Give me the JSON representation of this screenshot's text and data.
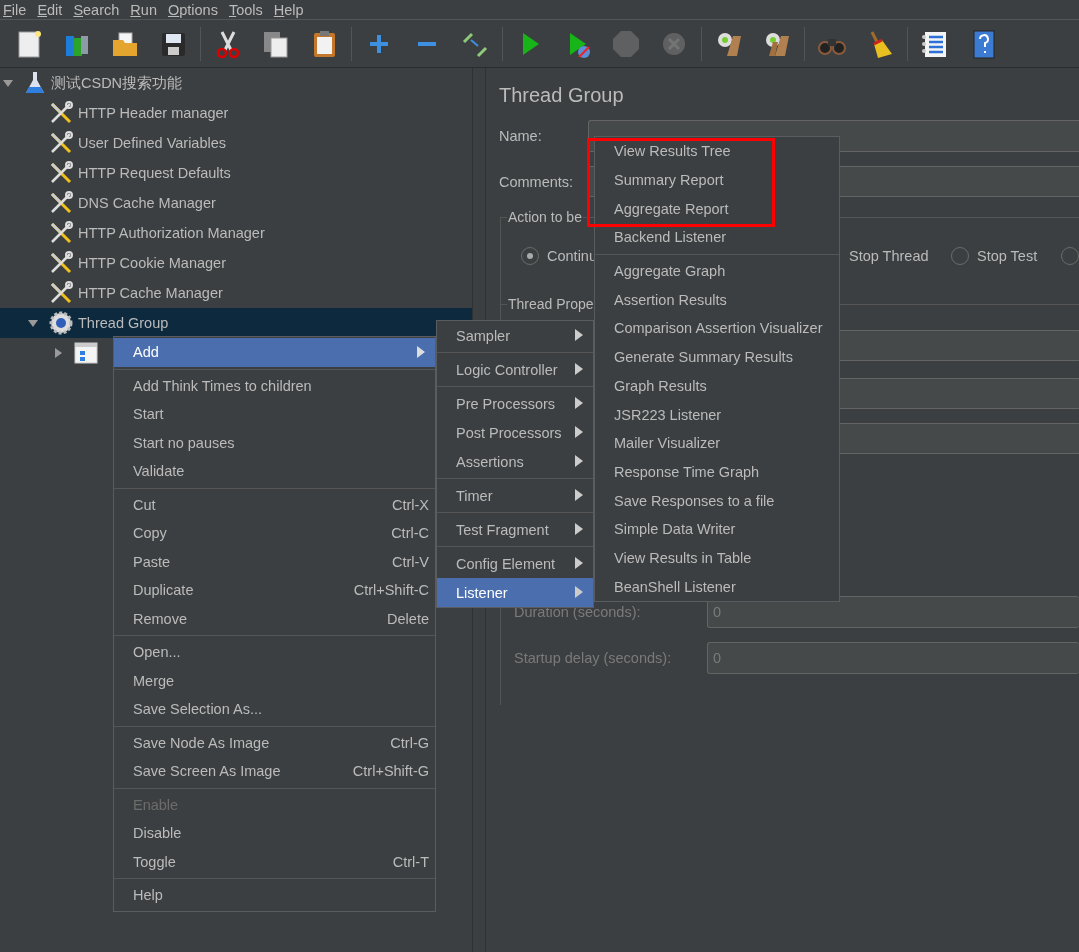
{
  "menubar": [
    "File",
    "Edit",
    "Search",
    "Run",
    "Options",
    "Tools",
    "Help"
  ],
  "toolbar": [
    {
      "kind": "new",
      "disabled": false
    },
    {
      "kind": "templates",
      "disabled": false
    },
    {
      "kind": "open",
      "disabled": false
    },
    {
      "kind": "save",
      "disabled": false
    },
    {
      "kind": "separator"
    },
    {
      "kind": "cut",
      "disabled": false
    },
    {
      "kind": "copy",
      "disabled": false
    },
    {
      "kind": "paste",
      "disabled": false
    },
    {
      "kind": "separator"
    },
    {
      "kind": "expand",
      "disabled": false
    },
    {
      "kind": "collapse",
      "disabled": false
    },
    {
      "kind": "toggle",
      "disabled": false
    },
    {
      "kind": "separator"
    },
    {
      "kind": "start",
      "disabled": false
    },
    {
      "kind": "start-no-pauses",
      "disabled": false
    },
    {
      "kind": "stop",
      "disabled": true
    },
    {
      "kind": "shutdown",
      "disabled": true
    },
    {
      "kind": "separator"
    },
    {
      "kind": "clear",
      "disabled": false
    },
    {
      "kind": "clear-all",
      "disabled": false
    },
    {
      "kind": "separator"
    },
    {
      "kind": "search",
      "disabled": false
    },
    {
      "kind": "reset-search",
      "disabled": false
    },
    {
      "kind": "separator"
    },
    {
      "kind": "functions",
      "disabled": false
    },
    {
      "kind": "help",
      "disabled": false
    }
  ],
  "tree": {
    "label": "测试CSDN搜索功能",
    "kind": "test-plan",
    "expanded": true,
    "selected": false,
    "children": [
      {
        "label": "HTTP Header manager",
        "kind": "config",
        "selected": false
      },
      {
        "label": "User Defined Variables",
        "kind": "config",
        "selected": false
      },
      {
        "label": "HTTP Request Defaults",
        "kind": "config",
        "selected": false
      },
      {
        "label": "DNS Cache Manager",
        "kind": "config",
        "selected": false
      },
      {
        "label": "HTTP Authorization Manager",
        "kind": "config",
        "selected": false
      },
      {
        "label": "HTTP Cookie Manager",
        "kind": "config",
        "selected": false
      },
      {
        "label": "HTTP Cache Manager",
        "kind": "config",
        "selected": false
      },
      {
        "label": "Thread Group",
        "kind": "thread-group",
        "expanded": true,
        "selected": true,
        "children": [
          {
            "kind": "controller",
            "expanded": false,
            "selected": false
          }
        ]
      }
    ]
  },
  "panel": {
    "title": "Thread Group",
    "name_label": "Name:",
    "comments_label": "Comments:",
    "action_section": {
      "label": "Action to be",
      "options": [
        {
          "label": "Continu",
          "selected": true
        },
        {
          "label": "Stop Thread"
        },
        {
          "label": "Stop Test",
          "selected": false
        },
        {
          "selected": false
        }
      ]
    },
    "properties_section": {
      "label": "Thread Prope",
      "fields": [
        {
          "label": "Duration (seconds):",
          "value": "0",
          "disabled": true
        },
        {
          "label": "Startup delay (seconds):",
          "value": "0",
          "disabled": true
        }
      ]
    }
  },
  "context_menu": [
    {
      "label": "Add",
      "submenu": true,
      "selected": true,
      "disabled": false
    },
    {
      "kind": "separator"
    },
    {
      "label": "Add Think Times to children",
      "selected": false,
      "disabled": false
    },
    {
      "label": "Start",
      "selected": false,
      "disabled": false
    },
    {
      "label": "Start no pauses",
      "selected": false,
      "disabled": false
    },
    {
      "label": "Validate",
      "selected": false,
      "disabled": false
    },
    {
      "kind": "separator"
    },
    {
      "label": "Cut",
      "shortcut": "Ctrl-X",
      "selected": false,
      "disabled": false
    },
    {
      "label": "Copy",
      "shortcut": "Ctrl-C",
      "selected": false,
      "disabled": false
    },
    {
      "label": "Paste",
      "shortcut": "Ctrl-V",
      "selected": false,
      "disabled": false
    },
    {
      "label": "Duplicate",
      "shortcut": "Ctrl+Shift-C",
      "selected": false,
      "disabled": false
    },
    {
      "label": "Remove",
      "shortcut": "Delete",
      "selected": false,
      "disabled": false
    },
    {
      "kind": "separator"
    },
    {
      "label": "Open...",
      "selected": false,
      "disabled": false
    },
    {
      "label": "Merge",
      "selected": false,
      "disabled": false
    },
    {
      "label": "Save Selection As...",
      "selected": false,
      "disabled": false
    },
    {
      "kind": "separator"
    },
    {
      "label": "Save Node As Image",
      "shortcut": "Ctrl-G",
      "selected": false,
      "disabled": false
    },
    {
      "label": "Save Screen As Image",
      "shortcut": "Ctrl+Shift-G",
      "selected": false,
      "disabled": false
    },
    {
      "kind": "separator"
    },
    {
      "label": "Enable",
      "selected": false,
      "disabled": true
    },
    {
      "label": "Disable",
      "selected": false,
      "disabled": false
    },
    {
      "label": "Toggle",
      "shortcut": "Ctrl-T",
      "selected": false,
      "disabled": false
    },
    {
      "kind": "separator"
    },
    {
      "label": "Help",
      "selected": false,
      "disabled": false
    }
  ],
  "add_submenu": [
    {
      "label": "Sampler",
      "selected": false
    },
    {
      "kind": "separator"
    },
    {
      "label": "Logic Controller",
      "selected": false
    },
    {
      "kind": "separator"
    },
    {
      "label": "Pre Processors",
      "selected": false
    },
    {
      "label": "Post Processors",
      "selected": false
    },
    {
      "label": "Assertions",
      "selected": false
    },
    {
      "kind": "separator"
    },
    {
      "label": "Timer",
      "selected": false
    },
    {
      "kind": "separator"
    },
    {
      "label": "Test Fragment",
      "selected": false
    },
    {
      "kind": "separator"
    },
    {
      "label": "Config Element",
      "selected": false
    },
    {
      "label": "Listener",
      "selected": true
    }
  ],
  "listener_submenu": [
    {
      "label": "View Results Tree",
      "highlighted": true
    },
    {
      "label": "Summary Report",
      "highlighted": true
    },
    {
      "label": "Aggregate Report",
      "highlighted": true
    },
    {
      "label": "Backend Listener",
      "highlighted": false
    },
    {
      "kind": "separator"
    },
    {
      "label": "Aggregate Graph",
      "highlighted": false
    },
    {
      "label": "Assertion Results",
      "highlighted": false
    },
    {
      "label": "Comparison Assertion Visualizer",
      "highlighted": false
    },
    {
      "label": "Generate Summary Results",
      "highlighted": false
    },
    {
      "label": "Graph Results",
      "highlighted": false
    },
    {
      "label": "JSR223 Listener",
      "highlighted": false
    },
    {
      "label": "Mailer Visualizer",
      "highlighted": false
    },
    {
      "label": "Response Time Graph",
      "highlighted": false
    },
    {
      "label": "Save Responses to a file",
      "highlighted": false
    },
    {
      "label": "Simple Data Writer",
      "highlighted": false
    },
    {
      "label": "View Results in Table",
      "highlighted": false
    },
    {
      "label": "BeanShell Listener",
      "highlighted": false
    }
  ]
}
